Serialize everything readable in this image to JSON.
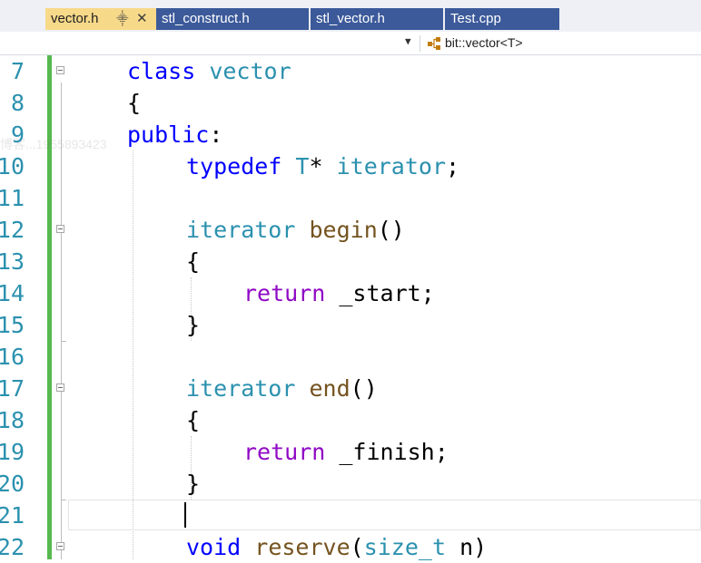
{
  "tabs": [
    {
      "label": "vector.h",
      "active": true,
      "pinned": true,
      "closable": true
    },
    {
      "label": "stl_construct.h",
      "active": false
    },
    {
      "label": "stl_vector.h",
      "active": false
    },
    {
      "label": "Test.cpp",
      "active": false
    }
  ],
  "navbar": {
    "scope_label": "bit::vector<T>",
    "dropdown_icon": "chevron-down-icon",
    "scope_icon": "class-icon"
  },
  "colors": {
    "tab_active_bg": "#f7d98a",
    "tab_inactive_bg": "#3c5a9a",
    "line_number": "#2b91af",
    "keyword": "#0000ff",
    "type": "#2b91af",
    "function": "#74531f",
    "control_keyword": "#8f08c4",
    "change_bar": "#57b84f"
  },
  "editor": {
    "lines": [
      {
        "num": "7",
        "indent": 1,
        "fold": true,
        "tokens": [
          [
            "kw",
            "class"
          ],
          [
            "plain",
            " "
          ],
          [
            "type",
            "vector"
          ]
        ]
      },
      {
        "num": "8",
        "indent": 1,
        "fold": false,
        "tokens": [
          [
            "plain",
            "{"
          ]
        ]
      },
      {
        "num": "9",
        "indent": 1,
        "fold": false,
        "tokens": [
          [
            "kw",
            "public"
          ],
          [
            "plain",
            ":"
          ]
        ]
      },
      {
        "num": "10",
        "indent": 2,
        "fold": false,
        "tokens": [
          [
            "kw",
            "typedef"
          ],
          [
            "plain",
            " "
          ],
          [
            "type",
            "T"
          ],
          [
            "plain",
            "* "
          ],
          [
            "type",
            "iterator"
          ],
          [
            "plain",
            ";"
          ]
        ]
      },
      {
        "num": "11",
        "indent": 2,
        "fold": false,
        "tokens": []
      },
      {
        "num": "12",
        "indent": 2,
        "fold": true,
        "tokens": [
          [
            "type",
            "iterator"
          ],
          [
            "plain",
            " "
          ],
          [
            "fn",
            "begin"
          ],
          [
            "plain",
            "()"
          ]
        ]
      },
      {
        "num": "13",
        "indent": 2,
        "fold": false,
        "tokens": [
          [
            "plain",
            "{"
          ]
        ]
      },
      {
        "num": "14",
        "indent": 3,
        "fold": false,
        "tokens": [
          [
            "ctl",
            "return"
          ],
          [
            "plain",
            " _start;"
          ]
        ]
      },
      {
        "num": "15",
        "indent": 2,
        "fold": false,
        "tokens": [
          [
            "plain",
            "}"
          ]
        ]
      },
      {
        "num": "16",
        "indent": 2,
        "fold": false,
        "tokens": []
      },
      {
        "num": "17",
        "indent": 2,
        "fold": true,
        "tokens": [
          [
            "type",
            "iterator"
          ],
          [
            "plain",
            " "
          ],
          [
            "fn",
            "end"
          ],
          [
            "plain",
            "()"
          ]
        ]
      },
      {
        "num": "18",
        "indent": 2,
        "fold": false,
        "tokens": [
          [
            "plain",
            "{"
          ]
        ]
      },
      {
        "num": "19",
        "indent": 3,
        "fold": false,
        "tokens": [
          [
            "ctl",
            "return"
          ],
          [
            "plain",
            " _finish;"
          ]
        ]
      },
      {
        "num": "20",
        "indent": 2,
        "fold": false,
        "tokens": [
          [
            "plain",
            "}"
          ]
        ]
      },
      {
        "num": "21",
        "indent": 2,
        "fold": false,
        "tokens": []
      },
      {
        "num": "22",
        "indent": 2,
        "fold": true,
        "tokens": [
          [
            "kw",
            "void"
          ],
          [
            "plain",
            " "
          ],
          [
            "fn",
            "reserve"
          ],
          [
            "plain",
            "("
          ],
          [
            "type",
            "size_t"
          ],
          [
            "plain",
            " n)"
          ]
        ]
      }
    ]
  }
}
